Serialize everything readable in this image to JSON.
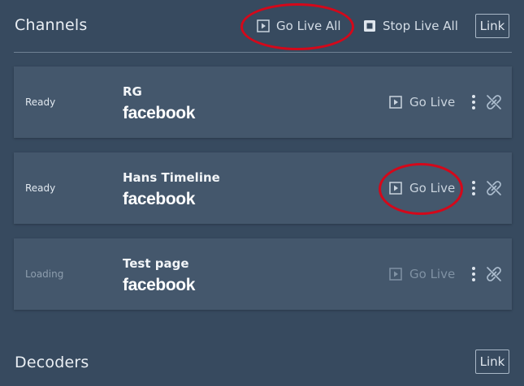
{
  "channels": {
    "title": "Channels",
    "go_live_all": "Go Live All",
    "stop_live_all": "Stop Live All",
    "link": "Link",
    "items": [
      {
        "status": "Ready",
        "name": "RG",
        "platform": "facebook",
        "action": "Go Live"
      },
      {
        "status": "Ready",
        "name": "Hans Timeline",
        "platform": "facebook",
        "action": "Go Live"
      },
      {
        "status": "Loading",
        "name": "Test page",
        "platform": "facebook",
        "action": "Go Live"
      }
    ]
  },
  "decoders": {
    "title": "Decoders",
    "link": "Link"
  },
  "colors": {
    "background": "#374a5f",
    "card": "#44576c",
    "highlight_ring": "#d4081a"
  }
}
